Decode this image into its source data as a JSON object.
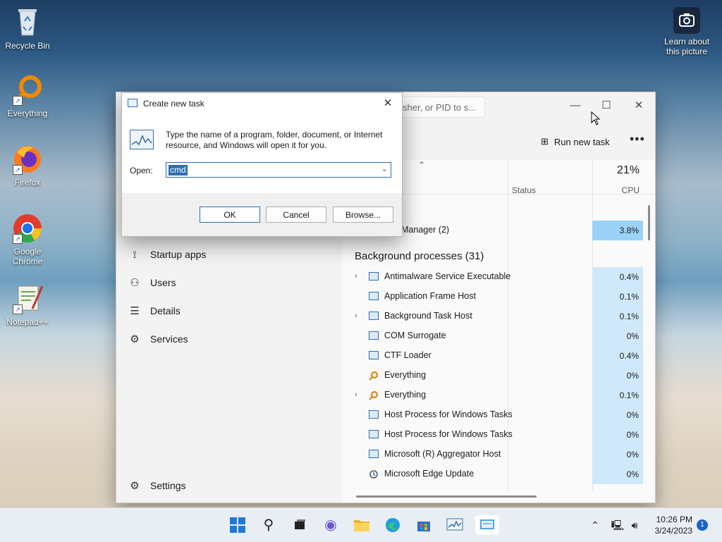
{
  "desktop": {
    "icons": [
      {
        "label": "Recycle Bin"
      },
      {
        "label": "Everything"
      },
      {
        "label": "Firefox"
      },
      {
        "label": "Google Chrome"
      },
      {
        "label": "Notepad++"
      }
    ],
    "learn_picture": "Learn about this picture"
  },
  "task_manager": {
    "search_placeholder": "sher, or PID to s...",
    "run_new_task": "Run new task",
    "more": "•••",
    "nav": [
      {
        "label": "Startup apps",
        "icon": "startup-icon"
      },
      {
        "label": "Users",
        "icon": "users-icon"
      },
      {
        "label": "Details",
        "icon": "details-icon"
      },
      {
        "label": "Services",
        "icon": "services-icon"
      }
    ],
    "settings": "Settings",
    "columns": {
      "status": "Status",
      "cpu_total": "21%",
      "cpu": "CPU"
    },
    "app_row": {
      "name": "Manager (2)",
      "cpu": "3.8%"
    },
    "group_title": "Background processes (31)",
    "processes": [
      {
        "name": "Antimalware Service Executable",
        "cpu": "0.4%",
        "expand": true,
        "icon": "app"
      },
      {
        "name": "Application Frame Host",
        "cpu": "0.1%",
        "expand": false,
        "icon": "app"
      },
      {
        "name": "Background Task Host",
        "cpu": "0.1%",
        "expand": true,
        "icon": "app"
      },
      {
        "name": "COM Surrogate",
        "cpu": "0%",
        "expand": false,
        "icon": "app"
      },
      {
        "name": "CTF Loader",
        "cpu": "0.4%",
        "expand": false,
        "icon": "app"
      },
      {
        "name": "Everything",
        "cpu": "0%",
        "expand": false,
        "icon": "everything"
      },
      {
        "name": "Everything",
        "cpu": "0.1%",
        "expand": true,
        "icon": "everything"
      },
      {
        "name": "Host Process for Windows Tasks",
        "cpu": "0%",
        "expand": false,
        "icon": "app"
      },
      {
        "name": "Host Process for Windows Tasks",
        "cpu": "0%",
        "expand": false,
        "icon": "app"
      },
      {
        "name": "Microsoft (R) Aggregator Host",
        "cpu": "0%",
        "expand": false,
        "icon": "app"
      },
      {
        "name": "Microsoft Edge Update",
        "cpu": "0%",
        "expand": false,
        "icon": "edge-update"
      }
    ]
  },
  "run_dialog": {
    "title": "Create new task",
    "message": "Type the name of a program, folder, document, or Internet resource, and Windows will open it for you.",
    "open_label": "Open:",
    "open_value": "cmd",
    "ok": "OK",
    "cancel": "Cancel",
    "browse": "Browse..."
  },
  "taskbar": {
    "time": "10:26 PM",
    "date": "3/24/2023",
    "notifications": "1"
  }
}
